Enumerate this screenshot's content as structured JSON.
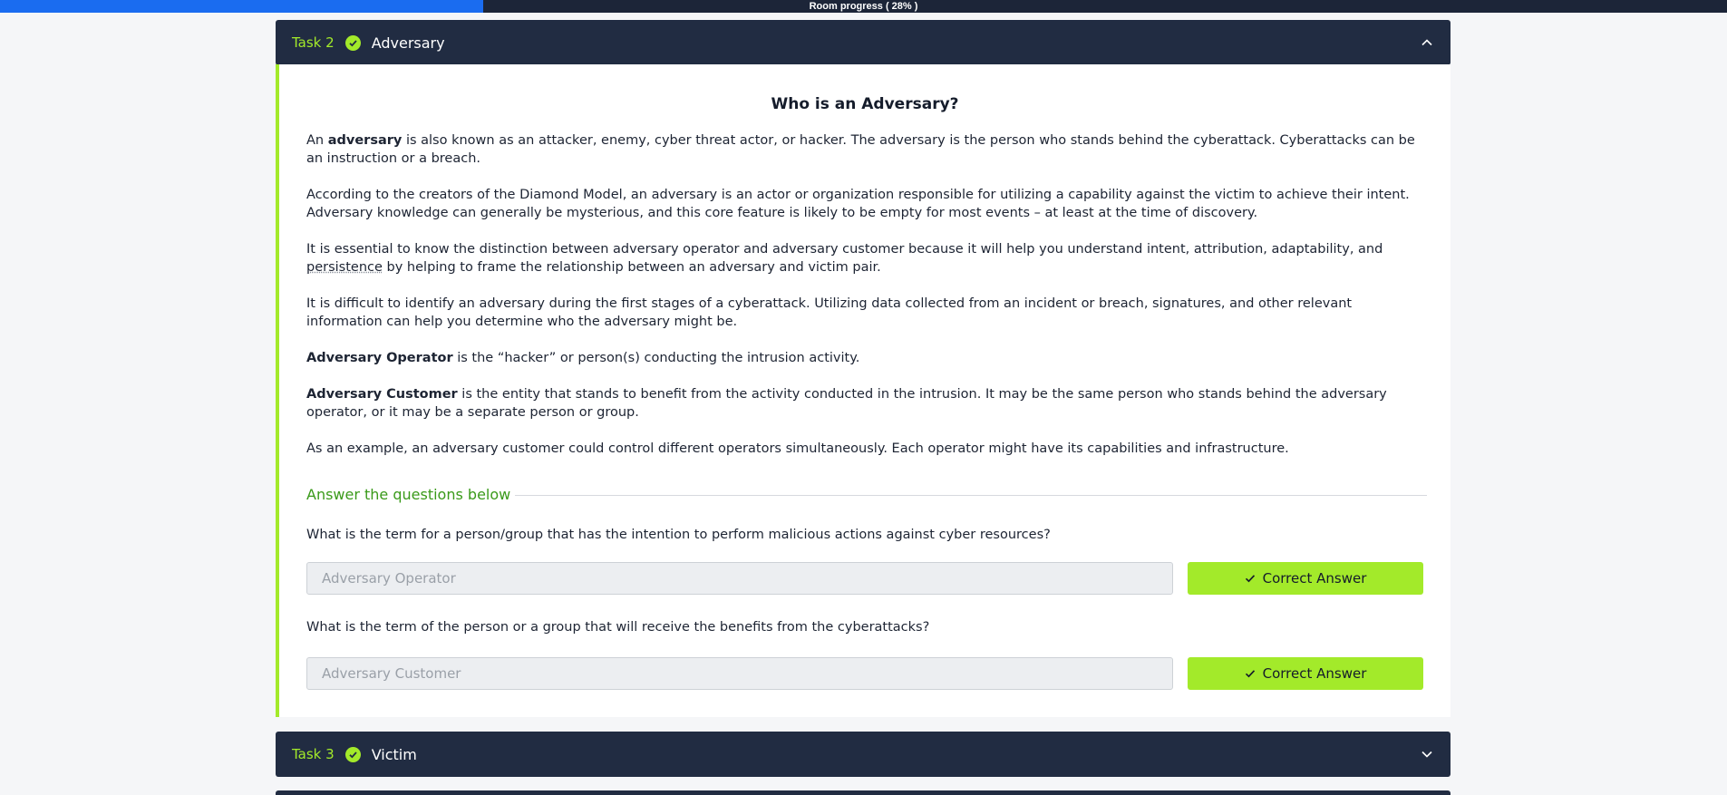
{
  "progress": {
    "label": "Room progress ( 28% )",
    "percent": 28,
    "fill_color": "#1a6cf0"
  },
  "task2": {
    "number": "Task 2",
    "title": "Adversary",
    "status_icon": "check-circle-icon",
    "expanded": true,
    "toggle_icon": "chevron-up-icon"
  },
  "article": {
    "title": "Who is an Adversary?",
    "p1_pre": "An ",
    "p1_bold": "adversary",
    "p1_post": " is also known as an attacker, enemy, cyber threat actor, or hacker. The adversary is the person who stands behind the cyberattack. Cyberattacks can be an instruction or a breach.",
    "p2": "According to the creators of the Diamond Model,  an adversary is an actor or organization responsible for utilizing a capability against the victim to achieve their intent. Adversary knowledge can generally be mysterious, and this core feature is likely to be empty for most events – at least at the time of discovery.",
    "p3_pre": "It is essential to know the distinction between adversary operator and adversary customer because it will help you understand intent, attribution, adaptability, and ",
    "p3_link": "persistence",
    "p3_post": " by helping to frame the relationship between an adversary and victim pair.",
    "p4": "It is difficult to identify an adversary during the first stages of a cyberattack. Utilizing data collected from an incident or breach, signatures, and other relevant information can help you determine who the adversary might be.",
    "p5_bold": "Adversary Operator",
    "p5_post": " is the “hacker” or person(s) conducting the intrusion activity.",
    "p6_bold": "Adversary Customer",
    "p6_post": " is the entity that stands to benefit from the activity conducted in the intrusion. It may be the same person who stands behind the adversary operator, or it may be a separate person or group.",
    "p7": "As an example, an adversary customer could control different operators simultaneously. Each operator might have its capabilities and infrastructure."
  },
  "questions_section": {
    "heading": "Answer the questions below",
    "items": [
      {
        "question": "What is the term for a person/group that has the intention to perform malicious actions against cyber resources?",
        "answer": "Adversary Operator",
        "button_label": "Correct Answer"
      },
      {
        "question": "What is the term of the person or a group that will receive the benefits from the cyberattacks?",
        "answer": "Adversary Customer",
        "button_label": "Correct Answer"
      }
    ]
  },
  "task3": {
    "number": "Task 3",
    "title": "Victim",
    "status_icon": "check-circle-icon",
    "expanded": false,
    "toggle_icon": "chevron-down-icon"
  },
  "colors": {
    "accent_green": "#a3ea2a",
    "header_navy": "#212c42",
    "heading_green": "#3a9a1a"
  }
}
